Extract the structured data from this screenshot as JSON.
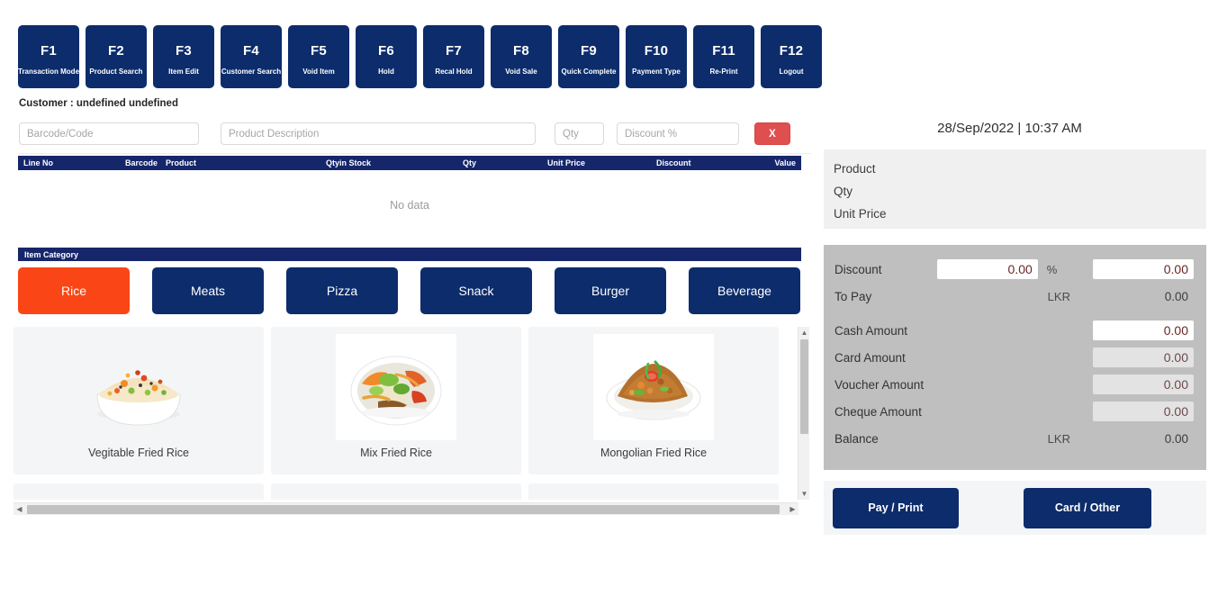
{
  "function_keys": [
    {
      "key": "F1",
      "label": "Transaction Mode"
    },
    {
      "key": "F2",
      "label": "Product Search"
    },
    {
      "key": "F3",
      "label": "Item Edit"
    },
    {
      "key": "F4",
      "label": "Customer Search"
    },
    {
      "key": "F5",
      "label": "Void Item"
    },
    {
      "key": "F6",
      "label": "Hold"
    },
    {
      "key": "F7",
      "label": "Recal Hold"
    },
    {
      "key": "F8",
      "label": "Void Sale"
    },
    {
      "key": "F9",
      "label": "Quick Complete"
    },
    {
      "key": "F10",
      "label": "Payment Type"
    },
    {
      "key": "F11",
      "label": "Re-Print"
    },
    {
      "key": "F12",
      "label": "Logout"
    }
  ],
  "customer": {
    "text": "Customer : undefined undefined"
  },
  "entry": {
    "barcode_placeholder": "Barcode/Code",
    "barcode_value": "",
    "description_placeholder": "Product Description",
    "description_value": "",
    "qty_placeholder": "Qty",
    "qty_value": "",
    "discount_placeholder": "Discount %",
    "discount_value": "",
    "clear_label": "X"
  },
  "grid": {
    "columns": [
      "Line No",
      "Barcode",
      "Product",
      "Qtyin Stock",
      "Qty",
      "Unit Price",
      "Discount",
      "Value"
    ],
    "empty_text": "No data",
    "rows": []
  },
  "item_category": {
    "title": "Item Category",
    "buttons": [
      {
        "label": "Rice",
        "active": true
      },
      {
        "label": "Meats",
        "active": false
      },
      {
        "label": "Pizza",
        "active": false
      },
      {
        "label": "Snack",
        "active": false
      },
      {
        "label": "Burger",
        "active": false
      },
      {
        "label": "Beverage",
        "active": false
      }
    ]
  },
  "products": [
    {
      "name": "Vegitable Fried Rice",
      "image": "fried-rice-bowl"
    },
    {
      "name": "Mix Fried Rice",
      "image": "mix-fried-rice-plate"
    },
    {
      "name": "Mongolian Fried Rice",
      "image": "mongolian-fried-rice-plate"
    }
  ],
  "right_panel": {
    "datetime": "28/Sep/2022 | 10:37 AM",
    "product_info": {
      "product_label": "Product",
      "qty_label": "Qty",
      "unit_price_label": "Unit Price"
    },
    "payment": {
      "discount_label": "Discount",
      "discount_value": "0.00",
      "percent_symbol": "%",
      "discount_amount_value": "0.00",
      "to_pay_label": "To Pay",
      "to_pay_currency": "LKR",
      "to_pay_value": "0.00",
      "cash_label": "Cash Amount",
      "cash_value": "0.00",
      "card_label": "Card Amount",
      "card_value": "0.00",
      "voucher_label": "Voucher Amount",
      "voucher_value": "0.00",
      "cheque_label": "Cheque Amount",
      "cheque_value": "0.00",
      "balance_label": "Balance",
      "balance_currency": "LKR",
      "balance_value": "0.00"
    },
    "actions": {
      "pay_print_label": "Pay / Print",
      "card_other_label": "Card / Other"
    }
  },
  "colors": {
    "navy": "#0c2c6b",
    "header_navy": "#16266b",
    "accent_orange": "#fa4616",
    "danger_red": "#e04f4f",
    "panel_gray": "#bfbfbf",
    "card_gray": "#f4f5f7",
    "value_maroon": "#6b2525"
  }
}
